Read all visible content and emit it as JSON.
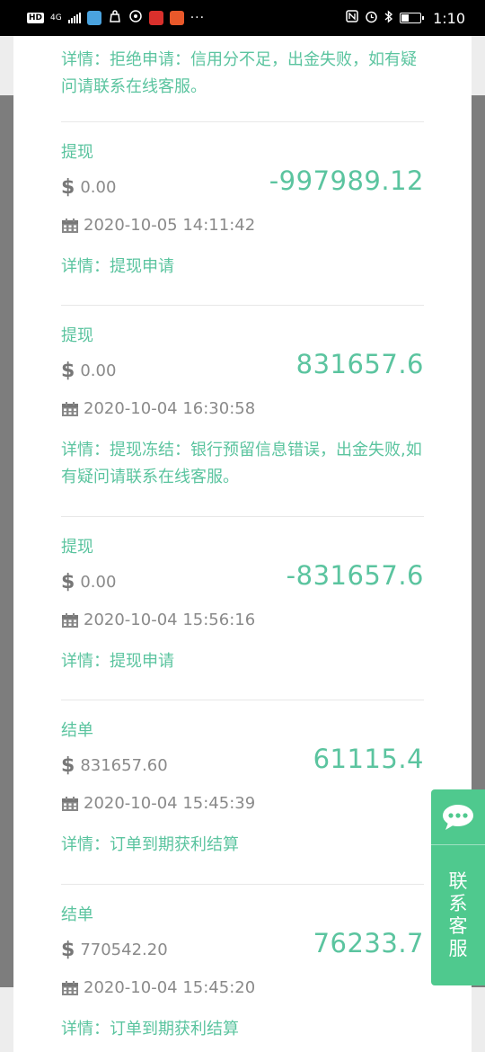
{
  "status_bar": {
    "hd": "HD",
    "net": "4G",
    "time": "1:10"
  },
  "top_detail": "详情：拒绝申请：信用分不足，出金失败，如有疑问请联系在线客服。",
  "records": [
    {
      "title": "提现",
      "balance": "0.00",
      "amount": "-997989.12",
      "date": "2020-10-05 14:11:42",
      "detail": "详情：提现申请"
    },
    {
      "title": "提现",
      "balance": "0.00",
      "amount": "831657.6",
      "date": "2020-10-04 16:30:58",
      "detail": "详情：提现冻结：银行预留信息错误，出金失败,如有疑问请联系在线客服。"
    },
    {
      "title": "提现",
      "balance": "0.00",
      "amount": "-831657.6",
      "date": "2020-10-04 15:56:16",
      "detail": "详情：提现申请"
    },
    {
      "title": "结单",
      "balance": "831657.60",
      "amount": "61115.4",
      "date": "2020-10-04 15:45:39",
      "detail": "详情：订单到期获利结算"
    },
    {
      "title": "结单",
      "balance": "770542.20",
      "amount": "76233.7",
      "date": "2020-10-04 15:45:20",
      "detail": "详情：订单到期获利结算"
    }
  ],
  "chat_widget": {
    "label": "联系客服",
    "icon": "chat-bubble-icon"
  },
  "colors": {
    "accent": "#5bc49f",
    "widget": "#4fc98e",
    "muted": "#8a8a8a"
  }
}
